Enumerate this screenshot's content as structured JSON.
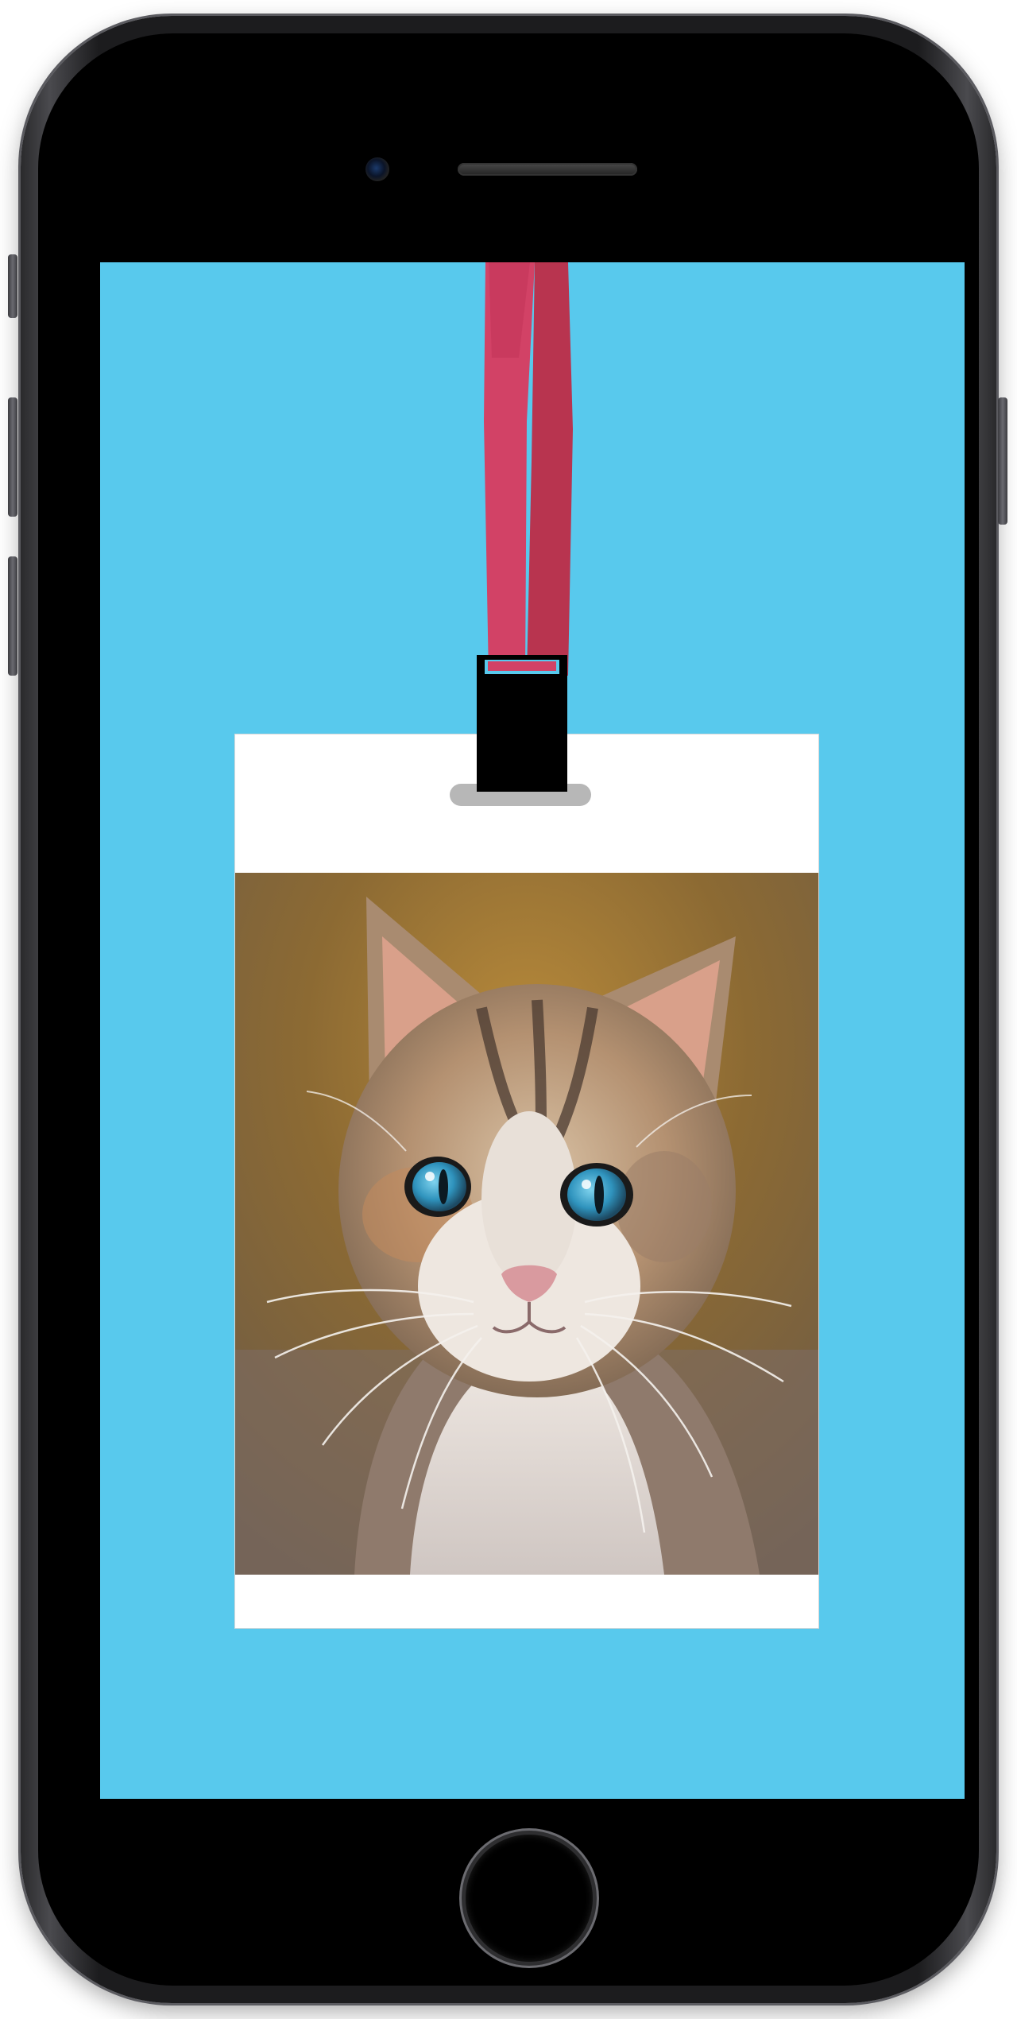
{
  "device": {
    "model": "phone",
    "frame_color": "#1c1c1e"
  },
  "screen": {
    "background_color": "#58c9ed"
  },
  "lanyard": {
    "strap_color": "#d24266",
    "strap_shadow_color": "#b8344f",
    "clip_color": "#000000"
  },
  "badge": {
    "card_color": "#ffffff",
    "slot_color": "#b7b7b7",
    "photo": {
      "subject": "cat-portrait",
      "eye_color": "#3aa0c9"
    }
  }
}
